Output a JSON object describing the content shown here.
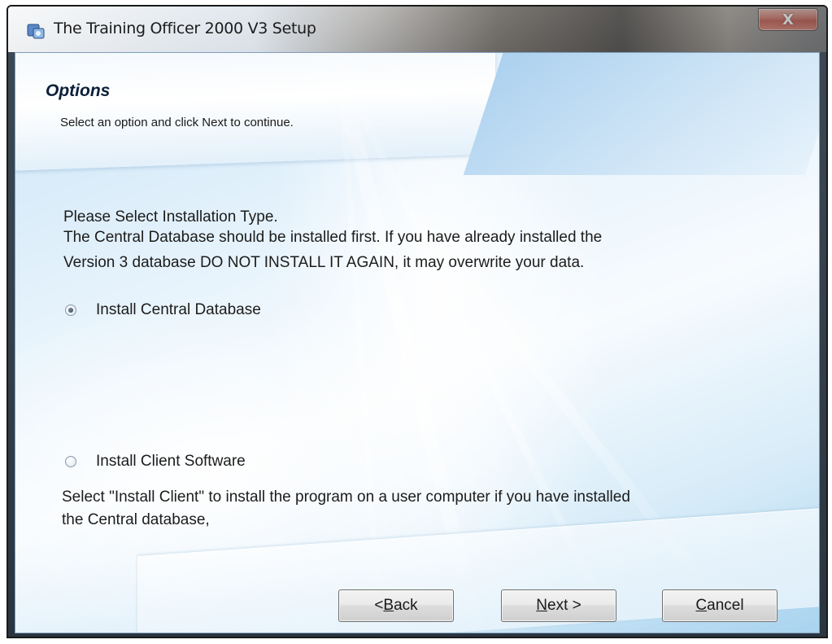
{
  "window": {
    "title": "The Training Officer 2000 V3 Setup",
    "close_glyph": "X",
    "icon": "installer-icon"
  },
  "header": {
    "title": "Options",
    "subtitle": "Select an option and click Next to continue."
  },
  "content": {
    "intro_line_1": "Please Select Installation Type.",
    "intro_line_2": "The Central Database should be installed first. If you have already installed the",
    "intro_line_3": "Version 3 database DO NOT INSTALL IT AGAIN, it may overwrite your data.",
    "options": [
      {
        "label": "Install Central Database",
        "selected": true
      },
      {
        "label": "Install Client Software",
        "selected": false
      }
    ],
    "client_note_line_1": "Select \"Install Client\" to install the program on a user computer if you have installed",
    "client_note_line_2": "the Central database,"
  },
  "buttons": {
    "back": {
      "prefix": "< ",
      "accel": "B",
      "rest": "ack"
    },
    "next": {
      "accel": "N",
      "rest": "ext >"
    },
    "cancel": {
      "accel": "C",
      "rest": "ancel"
    }
  },
  "colors": {
    "accent_blue": "#a9cfee",
    "title_text": "#0b1f3a"
  }
}
